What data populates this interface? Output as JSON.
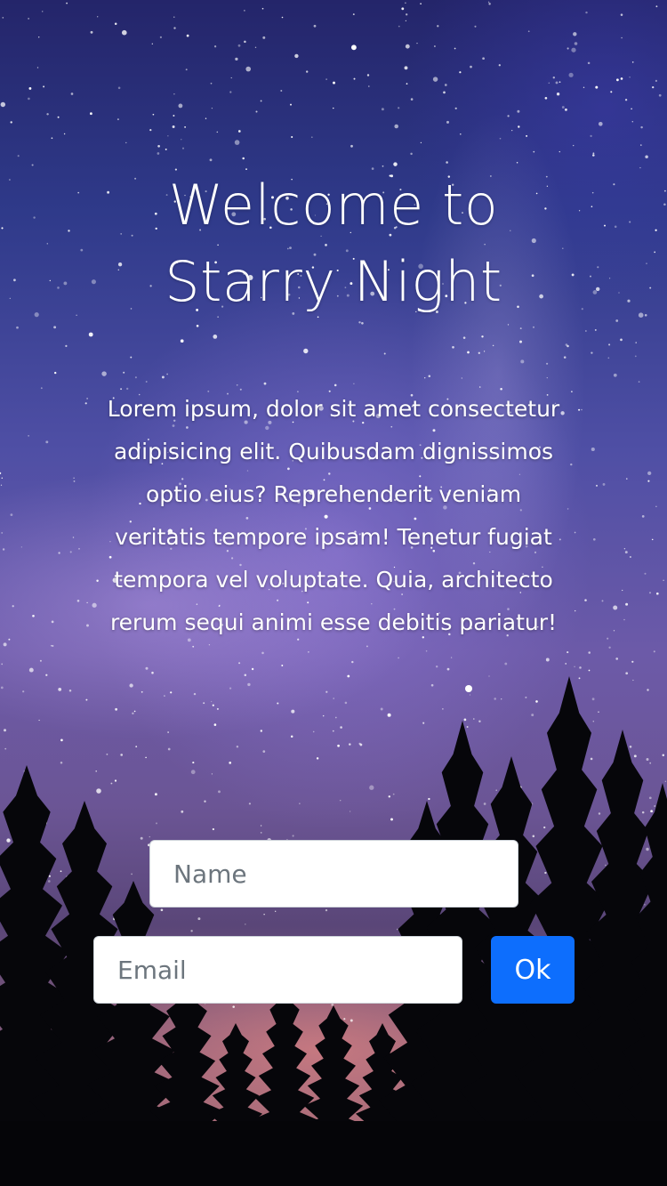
{
  "page": {
    "background": "starry-night-sky-with-pine-trees",
    "colors": {
      "sky_top": "#24256a",
      "sky_mid": "#6c5aa8",
      "horizon": "#b06f72",
      "text": "#ffffff",
      "button": "#0d6efd"
    }
  },
  "hero": {
    "title_line1": "Welcome to",
    "title_line2": "Starry Night",
    "description": "Lorem ipsum, dolor sit amet consectetur adipisicing elit. Quibusdam dignissimos optio eius? Reprehenderit veniam veritatis tempore ipsam! Tenetur fugiat tempora vel voluptate. Quia, architecto rerum sequi animi esse debitis pariatur!"
  },
  "form": {
    "name_placeholder": "Name",
    "name_value": "",
    "email_placeholder": "Email",
    "email_value": "",
    "submit_label": "Ok"
  }
}
